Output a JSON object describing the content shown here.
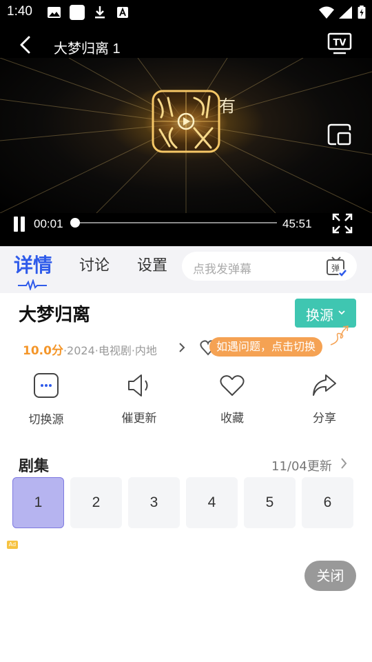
{
  "status_bar": {
    "time": "1:40"
  },
  "player": {
    "title": "大梦归离 1",
    "logo_side_text": "有",
    "current_time": "00:01",
    "total_time": "45:51",
    "progress": 0.0004
  },
  "tabs": [
    {
      "label": "详情"
    },
    {
      "label": "讨论"
    },
    {
      "label": "设置"
    }
  ],
  "danmu": {
    "placeholder": "点我发弹幕"
  },
  "detail": {
    "title": "大梦归离",
    "switch_source_label": "换源",
    "score": "10.0分",
    "meta": "·2024·电视剧·内地",
    "tip": "如遇问题，点击切换"
  },
  "actions": [
    {
      "label": "切换源",
      "icon": "switch-source-icon"
    },
    {
      "label": "催更新",
      "icon": "speaker-icon"
    },
    {
      "label": "收藏",
      "icon": "heart-icon"
    },
    {
      "label": "分享",
      "icon": "share-icon"
    }
  ],
  "episodes": {
    "title": "剧集",
    "update": "11/04更新",
    "items": [
      "1",
      "2",
      "3",
      "4",
      "5",
      "6"
    ],
    "selected": "1"
  },
  "ad": {
    "badge": "Ad",
    "close_label": "关闭"
  },
  "colors": {
    "accent": "#2f5bea",
    "switch_button": "#3fc6b1",
    "tip": "#f5a253",
    "score": "#f4962a",
    "episode_selected": "#b6b4f0"
  }
}
